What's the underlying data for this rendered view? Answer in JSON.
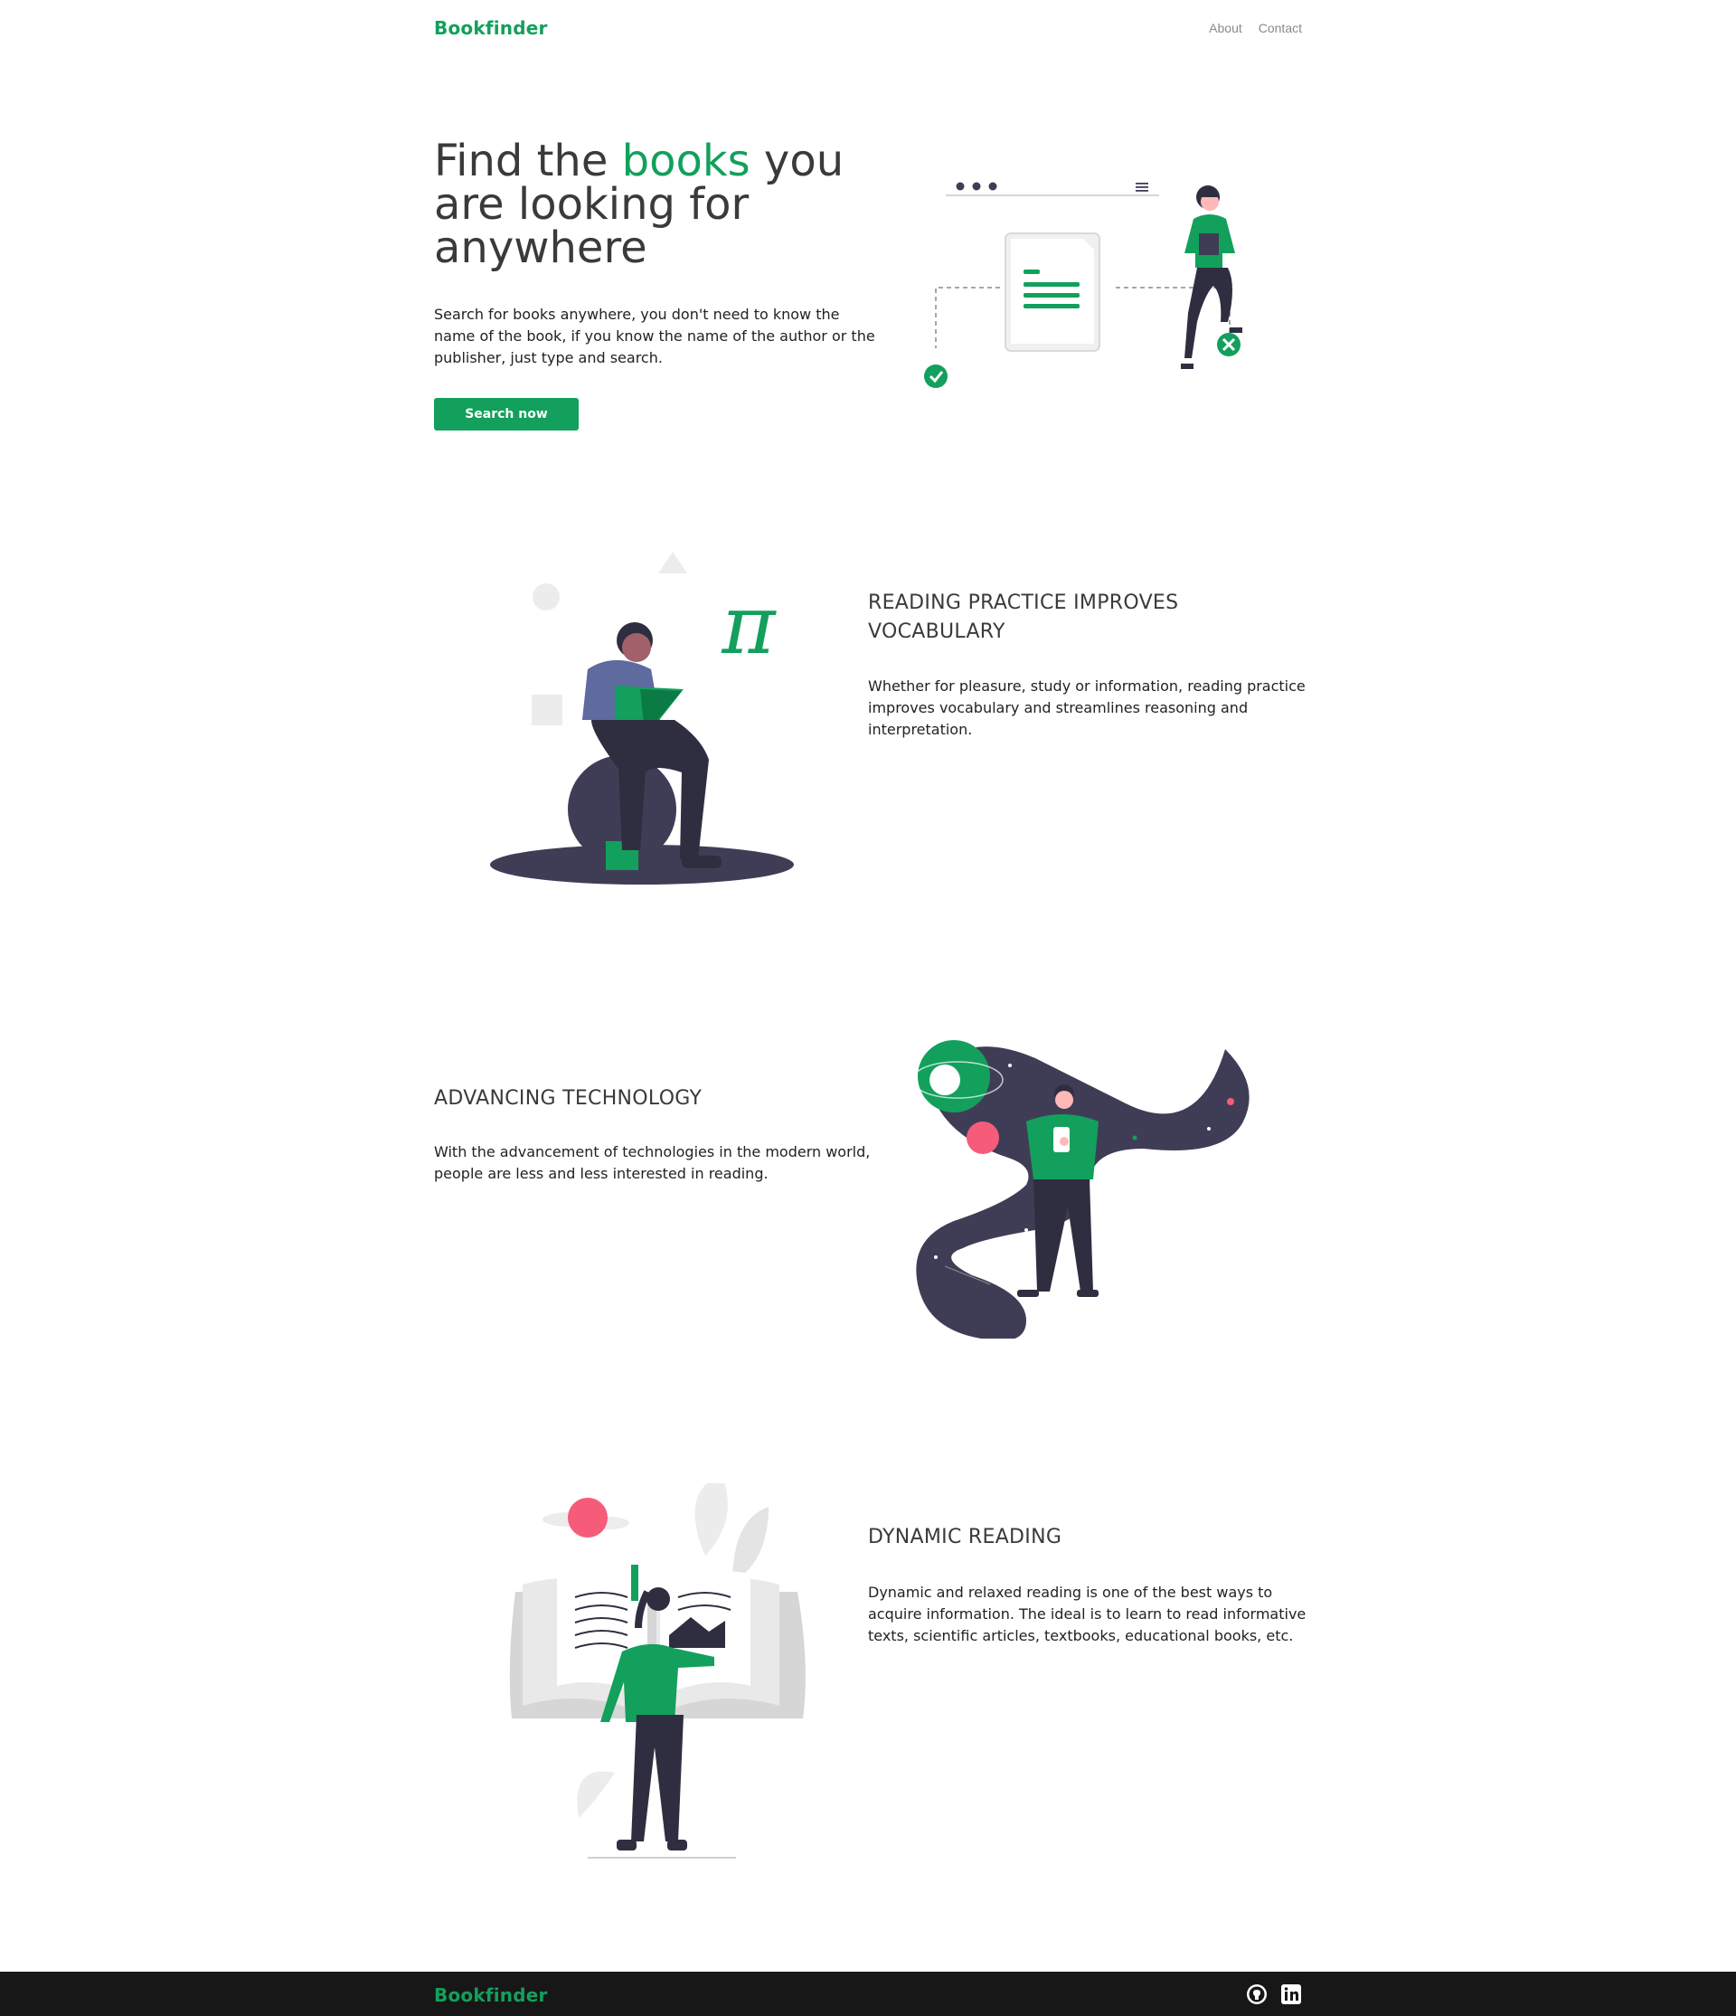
{
  "brand": "Bookfinder",
  "nav": {
    "about": "About",
    "contact": "Contact"
  },
  "hero": {
    "title_prefix": "Find the ",
    "title_accent": "books",
    "title_suffix": " you are looking for anywhere",
    "description": "Search for books anywhere, you don't need to know the name of the book, if you know the name of the author or the publisher, just type and search.",
    "button": "Search now"
  },
  "sections": [
    {
      "title": "READING PRACTICE IMPROVES VOCABULARY",
      "text": "Whether for pleasure, study or information, reading practice improves vocabulary and streamlines reasoning and interpretation."
    },
    {
      "title": "ADVANCING TECHNOLOGY",
      "text": "With the advancement of technologies in the modern world, people are less and less interested in reading."
    },
    {
      "title": "DYNAMIC READING",
      "text": "Dynamic and relaxed reading is one of the best ways to acquire information. The ideal is to learn to read informative texts, scientific articles, textbooks, educational books, etc."
    }
  ],
  "footer": {
    "brand": "Bookfinder",
    "icons": [
      "github-icon",
      "linkedin-icon"
    ]
  },
  "colors": {
    "accent": "#12a05c",
    "dark": "#3f3d56",
    "footer": "#171717",
    "pink": "#f75b7a"
  }
}
